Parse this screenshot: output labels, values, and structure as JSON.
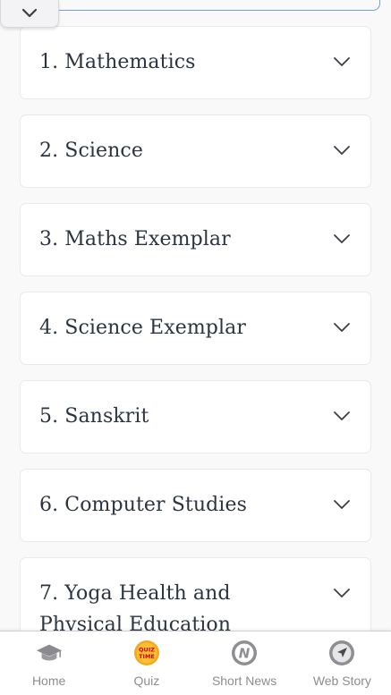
{
  "subjects": [
    {
      "label": "1. Mathematics"
    },
    {
      "label": "2. Science"
    },
    {
      "label": "3. Maths Exemplar"
    },
    {
      "label": "4. Science Exemplar"
    },
    {
      "label": "5. Sanskrit"
    },
    {
      "label": "6. Computer Studies"
    },
    {
      "label": "7. Yoga Health and Physical Education"
    }
  ],
  "bottom_nav": {
    "items": [
      {
        "label": "Home",
        "icon": "graduation-cap-icon"
      },
      {
        "label": "Quiz",
        "icon": "quiz-time-icon",
        "icon_text_top": "QUIZ",
        "icon_text_bottom": "TIME"
      },
      {
        "label": "Short News",
        "icon": "news-n-icon",
        "icon_text": "N"
      },
      {
        "label": "Web Story",
        "icon": "send-arrow-icon"
      }
    ]
  },
  "colors": {
    "title_text": "#2b3440",
    "nav_label": "#8d8d92",
    "quiz_badge": "#f5a623",
    "quiz_text": "#d0021b",
    "page_bg": "#f9f9fa",
    "card_bg": "#ffffff"
  }
}
